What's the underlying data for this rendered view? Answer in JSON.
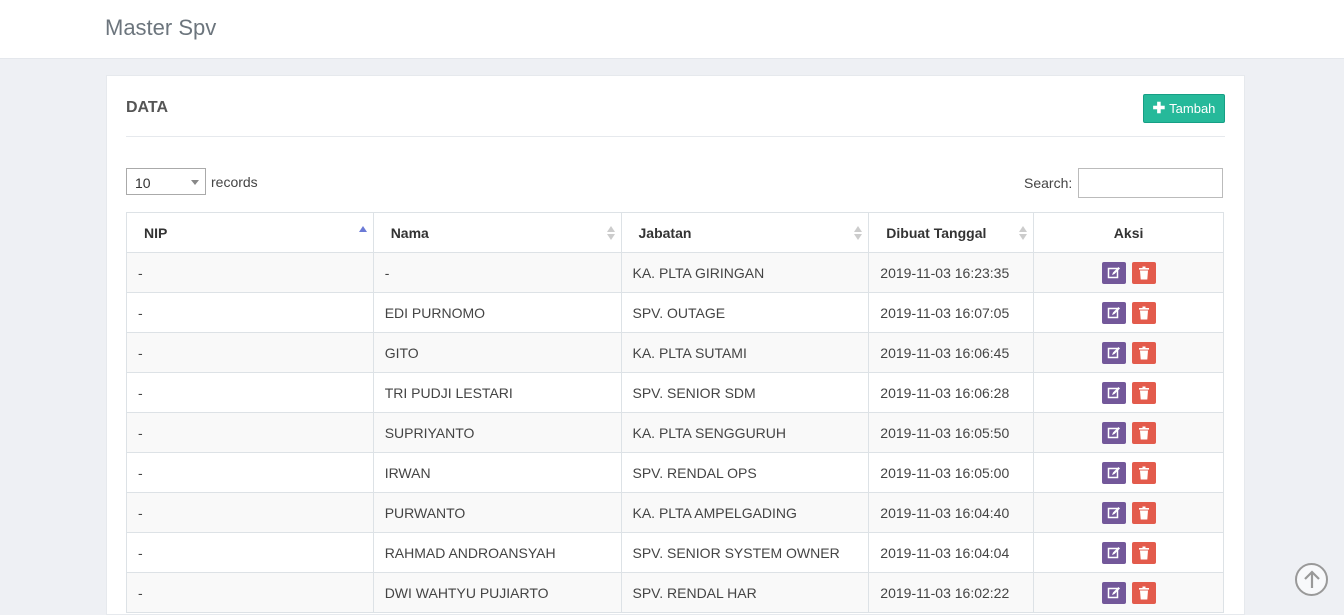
{
  "header": {
    "title": "Master Spv"
  },
  "panel": {
    "title": "DATA",
    "add_button": {
      "icon": "plus-icon",
      "label": "Tambah"
    }
  },
  "controls": {
    "length_value": "10",
    "length_suffix": "records",
    "search_label": "Search:",
    "search_value": ""
  },
  "table": {
    "columns": [
      "NIP",
      "Nama",
      "Jabatan",
      "Dibuat Tanggal",
      "Aksi"
    ],
    "sort_column": "NIP",
    "sort_direction": "asc",
    "rows": [
      {
        "nip": "-",
        "nama": "-",
        "jabatan": "KA. PLTA GIRINGAN",
        "tanggal": "2019-11-03 16:23:35"
      },
      {
        "nip": "-",
        "nama": "EDI PURNOMO",
        "jabatan": "SPV. OUTAGE",
        "tanggal": "2019-11-03 16:07:05"
      },
      {
        "nip": "-",
        "nama": "GITO",
        "jabatan": "KA. PLTA SUTAMI",
        "tanggal": "2019-11-03 16:06:45"
      },
      {
        "nip": "-",
        "nama": "TRI PUDJI LESTARI",
        "jabatan": "SPV. SENIOR SDM",
        "tanggal": "2019-11-03 16:06:28"
      },
      {
        "nip": "-",
        "nama": "SUPRIYANTO",
        "jabatan": "KA. PLTA SENGGURUH",
        "tanggal": "2019-11-03 16:05:50"
      },
      {
        "nip": "-",
        "nama": "IRWAN",
        "jabatan": "SPV. RENDAL OPS",
        "tanggal": "2019-11-03 16:05:00"
      },
      {
        "nip": "-",
        "nama": "PURWANTO",
        "jabatan": "KA. PLTA AMPELGADING",
        "tanggal": "2019-11-03 16:04:40"
      },
      {
        "nip": "-",
        "nama": "RAHMAD ANDROANSYAH",
        "jabatan": "SPV. SENIOR SYSTEM OWNER",
        "tanggal": "2019-11-03 16:04:04"
      },
      {
        "nip": "-",
        "nama": "DWI WAHTYU PUJIARTO",
        "jabatan": "SPV. RENDAL HAR",
        "tanggal": "2019-11-03 16:02:22"
      }
    ],
    "row_actions": [
      "edit-icon",
      "trash-icon"
    ]
  },
  "colors": {
    "add_button": "#26b99a",
    "edit_button": "#73589a",
    "delete_button": "#e35b4c"
  }
}
